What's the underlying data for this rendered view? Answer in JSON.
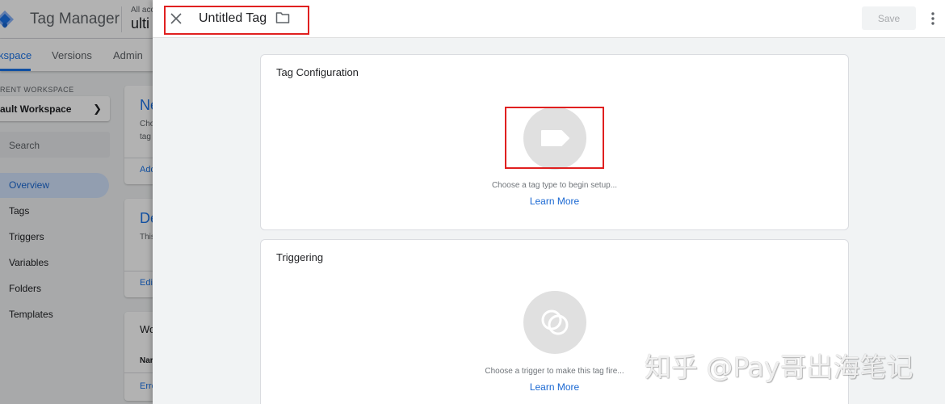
{
  "background": {
    "app_title": "Tag Manager",
    "account_label": "All acc",
    "container_name": "ulti",
    "tabs": [
      {
        "label": "kspace"
      },
      {
        "label": "Versions"
      },
      {
        "label": "Admin"
      }
    ],
    "current_workspace_label": "RENT WORKSPACE",
    "workspace_name": "ault Workspace",
    "search_placeholder": "Search",
    "nav": [
      {
        "label": "Overview"
      },
      {
        "label": "Tags"
      },
      {
        "label": "Triggers"
      },
      {
        "label": "Variables"
      },
      {
        "label": "Folders"
      },
      {
        "label": "Templates"
      }
    ],
    "cards": [
      {
        "title": "Ne",
        "lines": [
          "Cho",
          "tag"
        ],
        "link": "Add"
      },
      {
        "title": "De",
        "lines": [
          "This"
        ],
        "link": "Edit"
      },
      {
        "title": "Wo",
        "lines": [
          "Nar"
        ],
        "link": "Erro"
      }
    ]
  },
  "editor": {
    "tag_name": "Untitled Tag",
    "save_label": "Save",
    "tag_config": {
      "title": "Tag Configuration",
      "hint": "Choose a tag type to begin setup...",
      "learn_more": "Learn More"
    },
    "triggering": {
      "title": "Triggering",
      "hint": "Choose a trigger to make this tag fire...",
      "learn_more": "Learn More"
    }
  },
  "colors": {
    "accent": "#1a73e8",
    "highlight_box": "#e02020",
    "icon_circle": "#e0e0e0"
  },
  "watermark": "知乎 @Pay哥出海笔记"
}
